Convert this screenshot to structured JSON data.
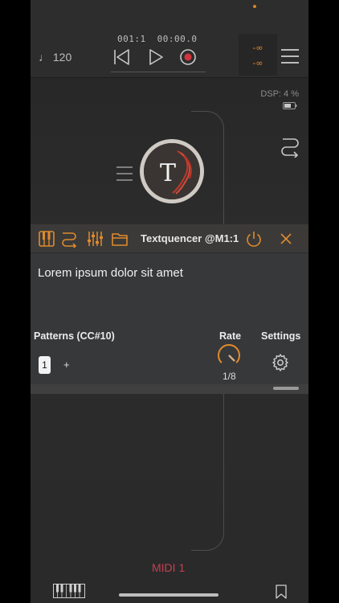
{
  "transport": {
    "tempo": "♩ 120",
    "position": "001:1",
    "time": "00:00.0"
  },
  "status": {
    "dsp": "DSP:  4 %"
  },
  "plugin": {
    "title": "Textquencer @M1:1",
    "text": "Lorem ipsum dolor sit amet",
    "patterns_label": "Patterns (CC#10)",
    "pattern_selected": "1",
    "add_pattern": "+",
    "rate_label": "Rate",
    "rate_value": "1/8",
    "settings_label": "Settings"
  },
  "node": {
    "letter": "T"
  },
  "bus": {
    "label": "MIDI 1"
  },
  "colors": {
    "accent": "#e08a2e",
    "midi_label": "#c24151"
  }
}
